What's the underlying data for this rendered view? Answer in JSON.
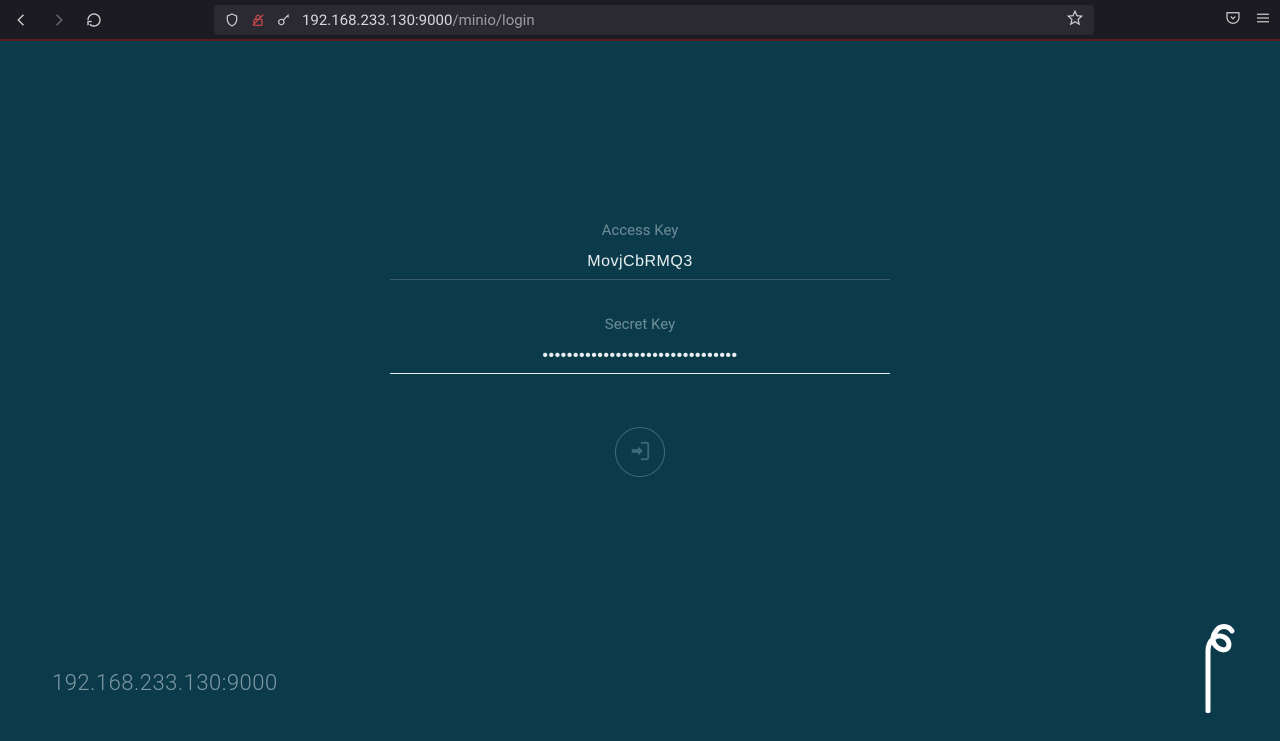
{
  "browser": {
    "url_host": "192.168.233.130:9000",
    "url_path": "/minio/login"
  },
  "login": {
    "access_key_label": "Access Key",
    "access_key_value": "MovjCbRMQ3",
    "secret_key_label": "Secret Key",
    "secret_key_value": "••••••••••••••••••••••••••••••••"
  },
  "footer": {
    "server_address": "192.168.233.130:9000"
  },
  "colors": {
    "page_bg": "#0b3b4b",
    "chrome_bg": "#1c1b22"
  }
}
